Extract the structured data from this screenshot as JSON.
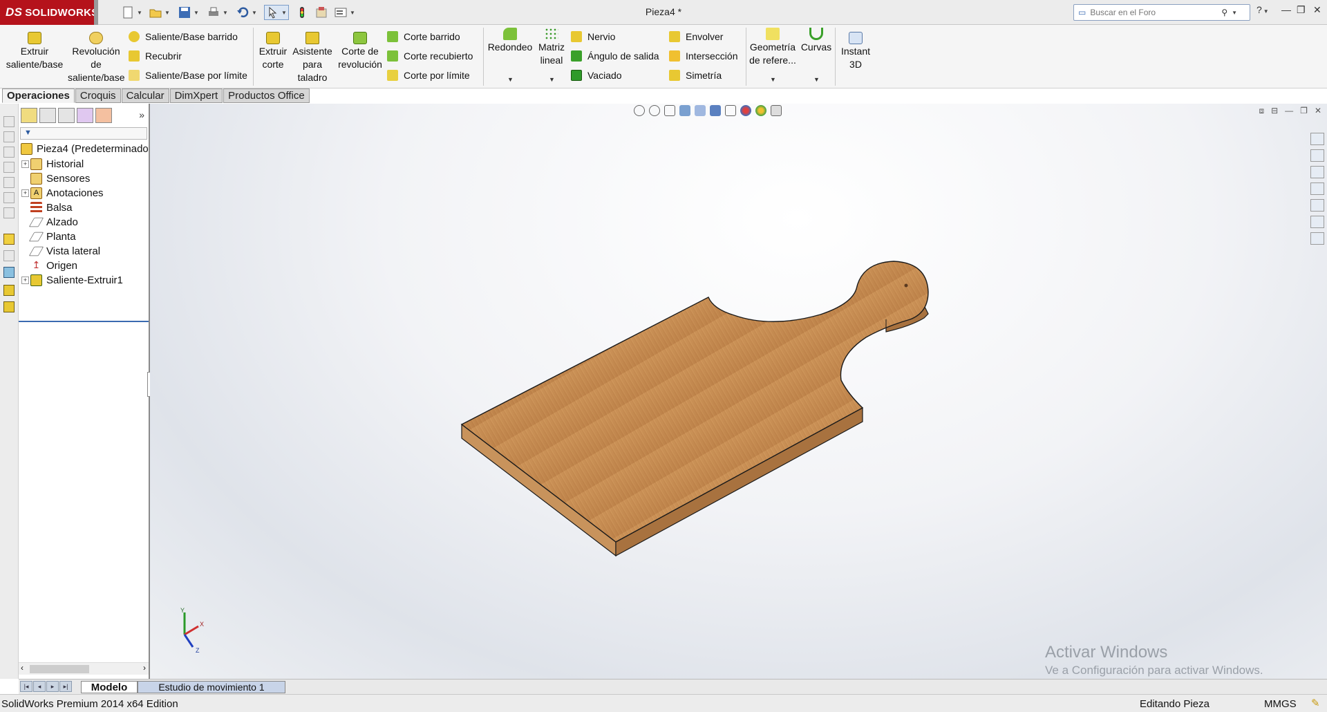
{
  "app": {
    "logo_text": "SOLIDWORKS",
    "logo_mark": "DS",
    "document_title": "Pieza4 *",
    "search_placeholder": "Buscar en el Foro",
    "brand_color": "#b5121b"
  },
  "quick_access": [
    "new-icon",
    "open-icon",
    "save-icon",
    "print-icon",
    "undo-icon",
    "select-icon",
    "rebuild-icon",
    "file-properties-icon",
    "options-icon"
  ],
  "ribbon": {
    "extrude_boss": "Extruir\nsaliente/base",
    "revolve_boss": "Revolución\nde\nsaliente/base",
    "swept_boss": "Saliente/Base barrido",
    "loft": "Recubrir",
    "boundary_boss": "Saliente/Base por límite",
    "extrude_cut": "Extruir\ncorte",
    "hole_wizard": "Asistente\npara\ntaladro",
    "revolve_cut": "Corte de\nrevolución",
    "swept_cut": "Corte barrido",
    "lofted_cut": "Corte recubierto",
    "boundary_cut": "Corte por límite",
    "fillet": "Redondeo",
    "linear_pattern": "Matriz\nlineal",
    "rib": "Nervio",
    "draft": "Ángulo de salida",
    "shell": "Vaciado",
    "wrap": "Envolver",
    "intersect": "Intersección",
    "mirror": "Simetría",
    "ref_geometry": "Geometría\nde refere...",
    "curves": "Curvas",
    "instant3d": "Instant\n3D"
  },
  "command_tabs": [
    "Operaciones",
    "Croquis",
    "Calcular",
    "DimXpert",
    "Productos Office"
  ],
  "feature_tree": {
    "root": "Pieza4  (Predeterminado",
    "items": [
      {
        "label": "Historial",
        "icon": "history-folder-icon",
        "expandable": true
      },
      {
        "label": "Sensores",
        "icon": "sensors-folder-icon",
        "expandable": false
      },
      {
        "label": "Anotaciones",
        "icon": "annotations-folder-icon",
        "expandable": true
      },
      {
        "label": "Balsa",
        "icon": "material-icon",
        "expandable": false
      },
      {
        "label": "Alzado",
        "icon": "plane-icon",
        "expandable": false
      },
      {
        "label": "Planta",
        "icon": "plane-icon",
        "expandable": false
      },
      {
        "label": "Vista lateral",
        "icon": "plane-icon",
        "expandable": false
      },
      {
        "label": "Origen",
        "icon": "origin-icon",
        "expandable": false
      },
      {
        "label": "Saliente-Extruir1",
        "icon": "extrude-feature-icon",
        "expandable": true
      }
    ]
  },
  "watermark": {
    "line1": "Activar Windows",
    "line2": "Ve a Configuración para activar Windows."
  },
  "model_tabs": [
    "Modelo",
    "Estudio de movimiento 1"
  ],
  "status": {
    "edition": "SolidWorks Premium 2014 x64 Edition",
    "mode": "Editando Pieza",
    "units": "MMGS"
  },
  "triad": {
    "x": "X",
    "y": "Y",
    "z": "Z"
  }
}
